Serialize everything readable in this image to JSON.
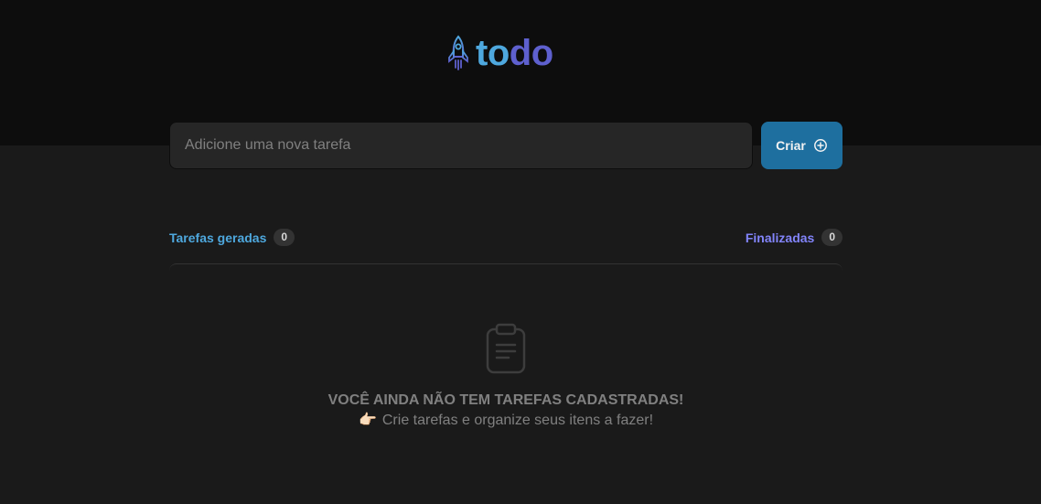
{
  "header": {
    "logo_part1": "to",
    "logo_part2": "do",
    "logo_icon": "rocket-icon"
  },
  "form": {
    "placeholder": "Adicione uma nova tarefa",
    "value": "",
    "create_label": "Criar",
    "create_icon": "plus-circle-icon"
  },
  "counters": {
    "created_label": "Tarefas geradas",
    "created_count": "0",
    "done_label": "Finalizadas",
    "done_count": "0"
  },
  "empty": {
    "icon": "clipboard-icon",
    "title": "VOCÊ AINDA NÃO TEM TAREFAS CADASTRADAS!",
    "pointer_emoji": "👉🏻",
    "subtitle": "Crie tarefas e organize seus itens a fazer!"
  },
  "colors": {
    "header_bg": "#0d0d0d",
    "body_bg": "#1a1a1a",
    "blue": "#4ea8de",
    "purple": "#5e60ce",
    "purple_light": "#8284fa",
    "button_bg": "#1e6f9f"
  }
}
